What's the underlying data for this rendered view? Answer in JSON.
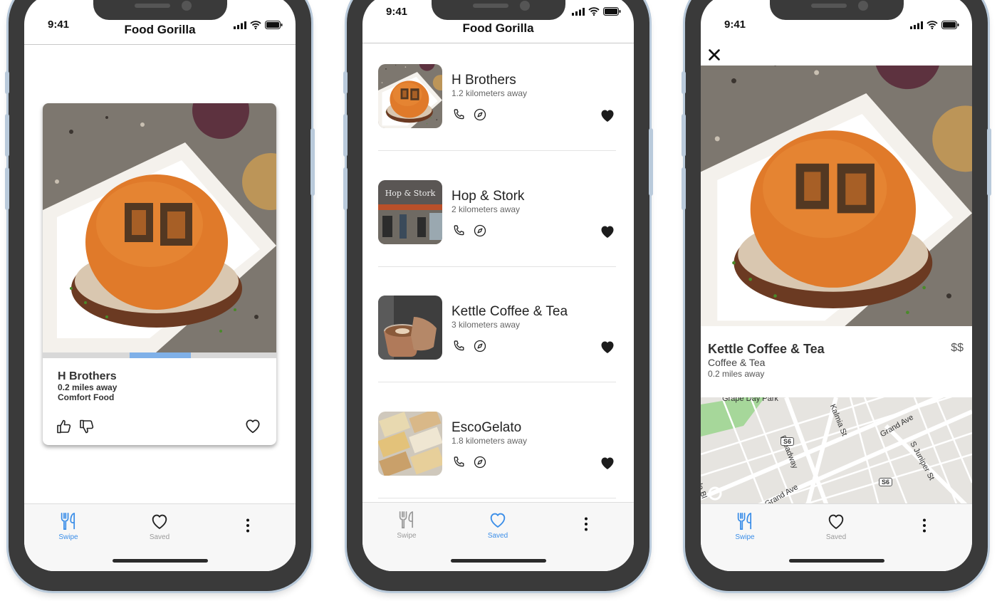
{
  "status": {
    "time": "9:41"
  },
  "app": {
    "title": "Food Gorilla"
  },
  "tabs": {
    "swipe": "Swipe",
    "saved": "Saved"
  },
  "swipe_card": {
    "name": "H Brothers",
    "distance": "0.2 miles away",
    "category": "Comfort Food",
    "photo_progress": 0.3
  },
  "saved_list": [
    {
      "name": "H Brothers",
      "distance": "1.2 kilometers away"
    },
    {
      "name": "Hop & Stork",
      "distance": "2 kilometers away",
      "thumb_text": "Hop & Stork"
    },
    {
      "name": "Kettle Coffee & Tea",
      "distance": "3 kilometers away"
    },
    {
      "name": "EscoGelato",
      "distance": "1.8 kilometers away"
    }
  ],
  "detail": {
    "name": "Kettle Coffee & Tea",
    "price": "$$",
    "category": "Coffee & Tea",
    "distance": "0.2 miles away",
    "map_labels": {
      "park": "Grape Day Park",
      "broadway": "Broadway",
      "kalmia": "Kalmia St",
      "grand_ave_1": "Grand Ave",
      "grand_ave_2": "Grand Ave",
      "juniper": "S Juniper St",
      "route_1": "S6",
      "route_2": "S6",
      "escondido": "do Bl"
    }
  },
  "colors": {
    "accent": "#3b8ee8",
    "inactive": "#9a9a9a",
    "frame": "#3a3a3a"
  }
}
